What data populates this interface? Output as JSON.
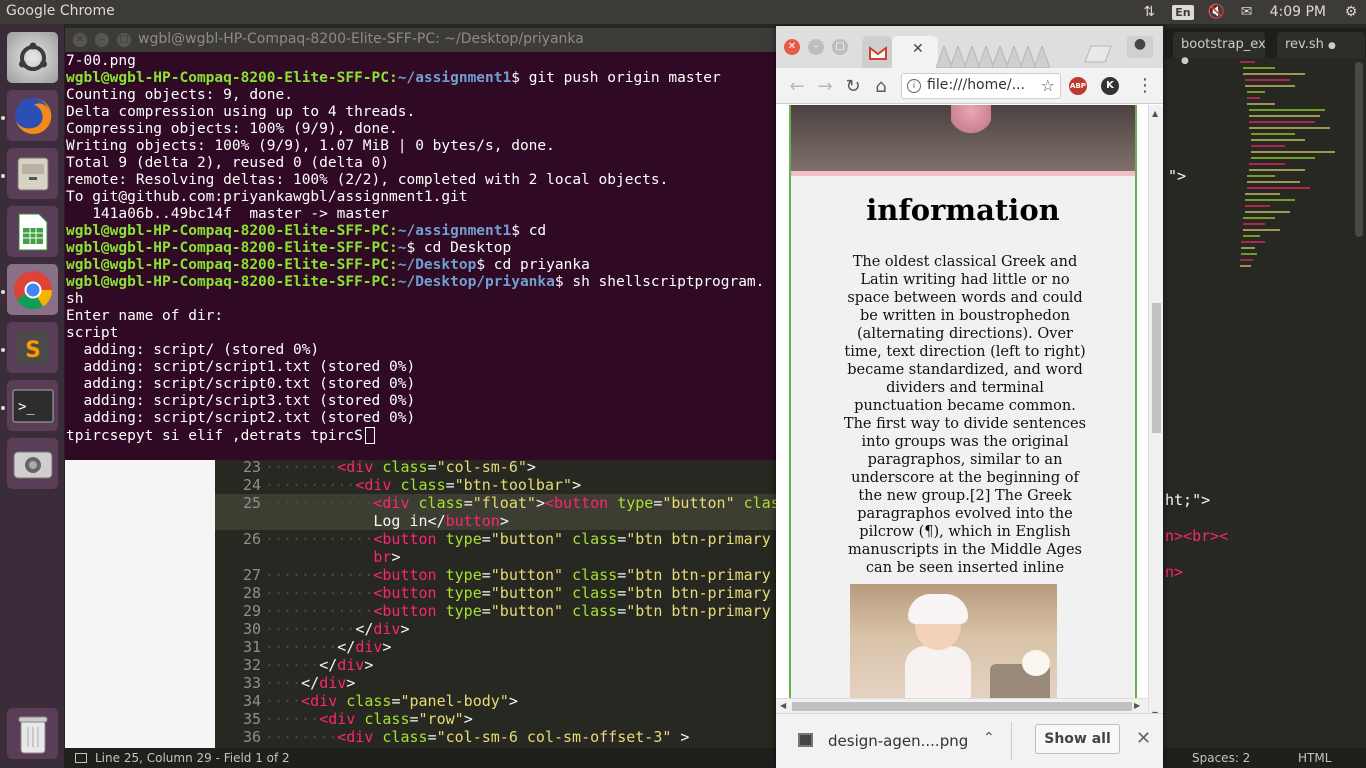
{
  "top_panel": {
    "app_name": "Google Chrome",
    "lang": "En",
    "clock": "4:09 PM"
  },
  "launcher": {
    "items": [
      "ubuntu-dash",
      "firefox",
      "files",
      "libreoffice-calc",
      "google-chrome",
      "sublime-text",
      "terminal",
      "cheese-webcam",
      "trash"
    ]
  },
  "terminal": {
    "title": "wgbl@wgbl-HP-Compaq-8200-Elite-SFF-PC: ~/Desktop/priyanka",
    "user_host": "wgbl@wgbl-HP-Compaq-8200-Elite-SFF-PC",
    "lines": [
      {
        "type": "out",
        "text": "7-00.png"
      },
      {
        "type": "prompt",
        "path": "~/assignment1",
        "cmd": "$ git push origin master"
      },
      {
        "type": "out",
        "text": "Counting objects: 9, done."
      },
      {
        "type": "out",
        "text": "Delta compression using up to 4 threads."
      },
      {
        "type": "out",
        "text": "Compressing objects: 100% (9/9), done."
      },
      {
        "type": "out",
        "text": "Writing objects: 100% (9/9), 1.07 MiB | 0 bytes/s, done."
      },
      {
        "type": "out",
        "text": "Total 9 (delta 2), reused 0 (delta 0)"
      },
      {
        "type": "out",
        "text": "remote: Resolving deltas: 100% (2/2), completed with 2 local objects."
      },
      {
        "type": "out",
        "text": "To git@github.com:priyankawgbl/assignment1.git"
      },
      {
        "type": "out",
        "text": "   141a06b..49bc14f  master -> master"
      },
      {
        "type": "prompt",
        "path": "~/assignment1",
        "cmd": "$ cd"
      },
      {
        "type": "prompt",
        "path": "~",
        "cmd": "$ cd Desktop"
      },
      {
        "type": "prompt",
        "path": "~/Desktop",
        "cmd": "$ cd priyanka"
      },
      {
        "type": "prompt",
        "path": "~/Desktop/priyanka",
        "cmd": "$ sh shellscriptprogram."
      },
      {
        "type": "out",
        "text": "sh"
      },
      {
        "type": "out",
        "text": "Enter name of dir:"
      },
      {
        "type": "out",
        "text": "script"
      },
      {
        "type": "out",
        "text": "  adding: script/ (stored 0%)"
      },
      {
        "type": "out",
        "text": "  adding: script/script1.txt (stored 0%)"
      },
      {
        "type": "out",
        "text": "  adding: script/script0.txt (stored 0%)"
      },
      {
        "type": "out",
        "text": "  adding: script/script3.txt (stored 0%)"
      },
      {
        "type": "out",
        "text": "  adding: script/script2.txt (stored 0%)"
      },
      {
        "type": "out",
        "text": "tpircsepyt si elif ,detrats tpircS"
      }
    ]
  },
  "editor": {
    "tabs": [
      "bootstrap_ex",
      "rev.sh"
    ],
    "code_lines": [
      {
        "n": "23",
        "html": "<span class=\"dots\">········</span><span class=\"tag\">&lt;div</span> <span class=\"attr\">class</span>=<span class=\"str\">\"col-sm-6\"</span>&gt;"
      },
      {
        "n": "24",
        "html": "<span class=\"dots\">··········</span><span class=\"tag\">&lt;div</span> <span class=\"attr\">class</span>=<span class=\"str\">\"btn-toolbar\"</span>&gt;"
      },
      {
        "n": "25",
        "html": "<span class=\"dots\">············</span><span class=\"tag\">&lt;div</span> <span class=\"attr\">class</span>=<span class=\"str\">\"float\"</span>&gt;<span class=\"tag\">&lt;button</span> <span class=\"attr\">type</span>=<span class=\"str\">\"button\"</span> <span class=\"attr\">class</span>"
      },
      {
        "n": "",
        "html": "            Log in&lt;/<span class=\"tag\">button</span>&gt;"
      },
      {
        "n": "26",
        "html": "<span class=\"dots\">············</span><span class=\"tag\">&lt;button</span> <span class=\"attr\">type</span>=<span class=\"str\">\"button\"</span> <span class=\"attr\">class</span>=<span class=\"str\">\"btn btn-primary b</span>"
      },
      {
        "n": "",
        "html": "            <span class=\"tag\">br</span>&gt;"
      },
      {
        "n": "27",
        "html": "<span class=\"dots\">············</span><span class=\"tag\">&lt;button</span> <span class=\"attr\">type</span>=<span class=\"str\">\"button\"</span> <span class=\"attr\">class</span>=<span class=\"str\">\"btn btn-primary b</span>"
      },
      {
        "n": "28",
        "html": "<span class=\"dots\">············</span><span class=\"tag\">&lt;button</span> <span class=\"attr\">type</span>=<span class=\"str\">\"button\"</span> <span class=\"attr\">class</span>=<span class=\"str\">\"btn btn-primary b</span>"
      },
      {
        "n": "29",
        "html": "<span class=\"dots\">············</span><span class=\"tag\">&lt;button</span> <span class=\"attr\">type</span>=<span class=\"str\">\"button\"</span> <span class=\"attr\">class</span>=<span class=\"str\">\"btn btn-primary b</span>"
      },
      {
        "n": "30",
        "html": "<span class=\"dots\">··········</span>&lt;/<span class=\"tag\">div</span>&gt;"
      },
      {
        "n": "31",
        "html": "<span class=\"dots\">········</span>&lt;/<span class=\"tag\">div</span>&gt;"
      },
      {
        "n": "32",
        "html": "<span class=\"dots\">······</span>&lt;/<span class=\"tag\">div</span>&gt;"
      },
      {
        "n": "33",
        "html": "<span class=\"dots\">····</span>&lt;/<span class=\"tag\">div</span>&gt;"
      },
      {
        "n": "34",
        "html": "<span class=\"dots\">····</span><span class=\"tag\">&lt;div</span> <span class=\"attr\">class</span>=<span class=\"str\">\"panel-body\"</span>&gt;"
      },
      {
        "n": "35",
        "html": "<span class=\"dots\">······</span><span class=\"tag\">&lt;div</span> <span class=\"attr\">class</span>=<span class=\"str\">\"row\"</span>&gt;"
      },
      {
        "n": "36",
        "html": "<span class=\"dots\">········</span><span class=\"tag\">&lt;div</span> <span class=\"attr\">class</span>=<span class=\"str\">\"col-sm-6 col-sm-offset-3\"</span> &gt;"
      }
    ],
    "right_fragments": [
      "\">",
      "ht;\">",
      "n><br><",
      "n>"
    ],
    "status": {
      "position": "Line 25, Column 29 - Field 1 of 2",
      "spaces": "Spaces: 2",
      "syntax": "HTML"
    }
  },
  "chrome": {
    "url": "file:///home/...",
    "page": {
      "heading": "information",
      "paragraph": "The oldest classical Greek and Latin writing had little or no space between words and could be written in boustrophedon (alternating directions). Over time, text direction (left to right) became standardized, and word dividers and terminal punctuation became common. The first way to divide sentences into groups was the original paragraphos, similar to an underscore at the beginning of the new group.[2] The Greek paragraphos evolved into the pilcrow (¶), which in English manuscripts in the Middle Ages can be seen inserted inline"
    },
    "download": {
      "filename": "design-agen....png",
      "show_all": "Show all"
    }
  }
}
